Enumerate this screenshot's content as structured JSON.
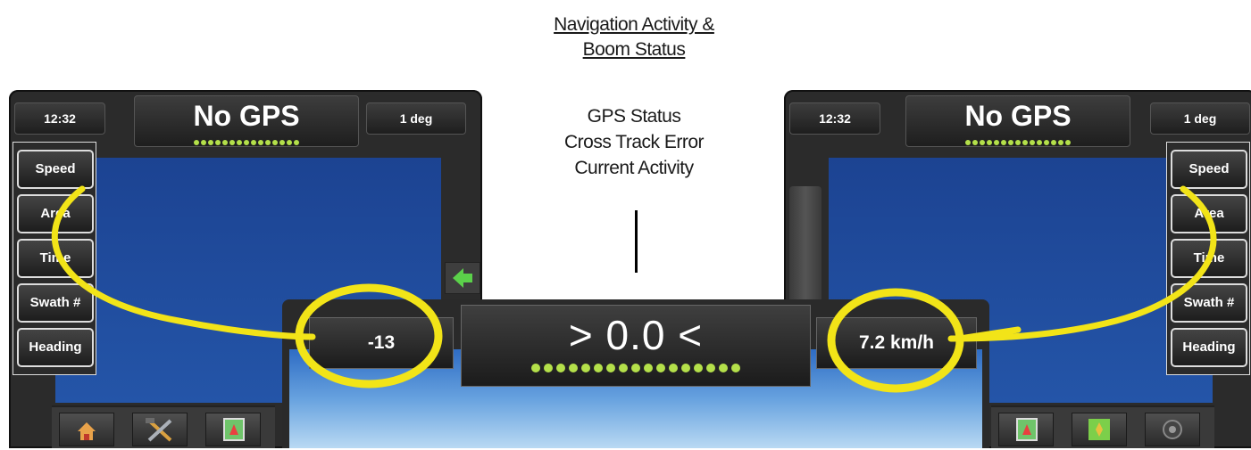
{
  "caption": {
    "title_line1": "Navigation Activity & ",
    "title_line2": "Boom Status",
    "list": [
      "GPS Status",
      "Cross Track Error",
      "Current Activity"
    ]
  },
  "left_console": {
    "clock": "12:32",
    "gps_status": "No GPS",
    "heading_deg": "1 deg",
    "buttons": [
      "Speed",
      "Area",
      "Time",
      "Swath #",
      "Heading"
    ]
  },
  "right_console": {
    "clock": "12:32",
    "gps_status": "No GPS",
    "heading_deg": "1 deg",
    "buttons": [
      "Speed",
      "Area",
      "Time",
      "Swath #",
      "Heading"
    ]
  },
  "center_console": {
    "left_value": "-13",
    "cross_track": "> 0.0 <",
    "right_value": "7.2 km/h"
  },
  "colors": {
    "highlight": "#f2e418",
    "led_green": "#b4e04a",
    "screen_blue": "#1f4a9a"
  }
}
